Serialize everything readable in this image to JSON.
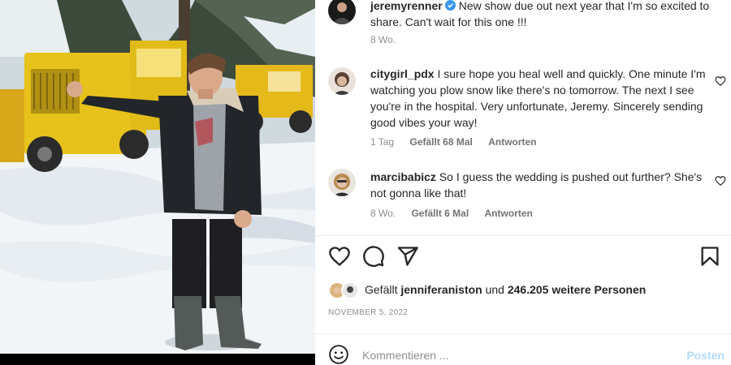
{
  "post": {
    "author": "jeremyrenner",
    "caption": "New show due out next year that I'm so excited to share. Can't wait for this one !!!",
    "age": "8 Wo."
  },
  "comments": [
    {
      "user": "citygirl_pdx",
      "text": "I sure hope you heal well and quickly. One minute I'm watching you plow snow like there's no tomorrow. The next I see you're in the hospital. Very unfortunate, Jeremy. Sincerely sending good vibes your way!",
      "age": "1 Tag",
      "likes": "Gefällt 68 Mal",
      "reply": "Antworten"
    },
    {
      "user": "marcibabicz",
      "text": "So I guess the wedding is pushed out further? She's not gonna like that!",
      "age": "8 Wo.",
      "likes": "Gefällt 6 Mal",
      "reply": "Antworten"
    }
  ],
  "likes_line": {
    "prefix": "Gefällt",
    "liker": "jenniferaniston",
    "joiner": "und",
    "others": "246.205 weitere Personen"
  },
  "date": "NOVEMBER 5, 2022",
  "add_comment": {
    "placeholder": "Kommentieren ...",
    "post_label": "Posten"
  },
  "icons": {
    "like": "heart-icon",
    "comment": "comment-icon",
    "share": "share-icon",
    "save": "bookmark-icon",
    "emoji": "emoji-icon",
    "verified": "verified-badge-icon"
  },
  "colors": {
    "verified": "#3897f0",
    "post_disabled": "#b3dbff",
    "secondary_text": "#8e8e8e"
  }
}
